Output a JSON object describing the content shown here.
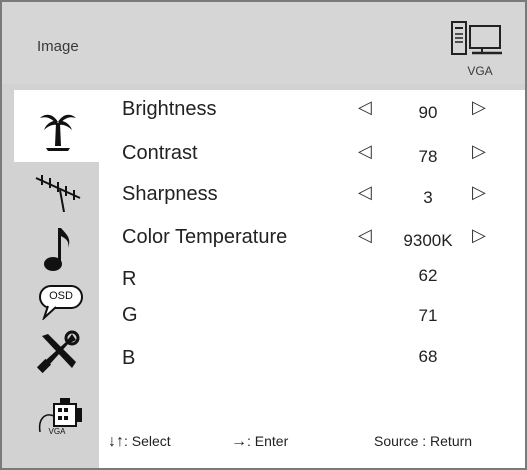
{
  "header": {
    "title": "Image",
    "source_label": "VGA"
  },
  "menu": [
    {
      "label": "Brightness",
      "value": "90"
    },
    {
      "label": "Contrast",
      "value": "78"
    },
    {
      "label": "Sharpness",
      "value": "3"
    },
    {
      "label": "Color Temperature",
      "value": "9300K"
    },
    {
      "label": "R",
      "value": "62"
    },
    {
      "label": "G",
      "value": "71"
    },
    {
      "label": "B",
      "value": "68"
    }
  ],
  "sidebar_icons": [
    "palm-tree-icon",
    "antenna-icon",
    "music-note-icon",
    "osd-bubble-icon",
    "tools-icon",
    "vga-connector-icon"
  ],
  "sidebar": {
    "osd_label": "OSD",
    "vga_label": "VGA"
  },
  "arrows": {
    "left": "◁",
    "right": "▷"
  },
  "footer": {
    "select_symbol": "↓↑",
    "select_text": ": Select",
    "enter_symbol": "→",
    "enter_text": ": Enter",
    "source_text": "Source : Return"
  }
}
